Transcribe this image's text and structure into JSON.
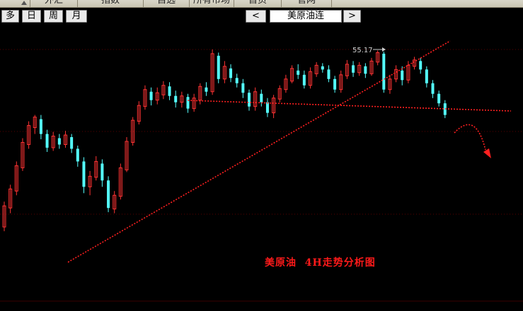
{
  "top_nav": {
    "tabs": [
      "外汇",
      "指数",
      "自选",
      "所有市场",
      "首页",
      "官网"
    ]
  },
  "toolbar": {
    "periods": [
      "多",
      "日",
      "周",
      "月"
    ],
    "prev": "<",
    "next": ">",
    "symbol": "美原油连"
  },
  "annotations": {
    "peak_label": "55.17",
    "caption": "美原油  4H走势分析图"
  },
  "colors": {
    "up": "#ff3333",
    "down": "#54ffff",
    "trendline": "#ff2020",
    "background": "#000000",
    "grid": "#5a0000"
  },
  "chart_data": {
    "type": "candlestick",
    "y_range": [
      36,
      57
    ],
    "candles": [
      [
        38.6,
        40.6,
        38.2,
        41.0
      ],
      [
        40.4,
        42.2,
        39.9,
        42.6
      ],
      [
        42.0,
        44.4,
        41.6,
        44.8
      ],
      [
        44.2,
        46.6,
        43.9,
        47.0
      ],
      [
        46.4,
        48.2,
        46.0,
        48.6
      ],
      [
        48.0,
        49.0,
        47.4,
        49.2
      ],
      [
        48.8,
        47.4,
        46.9,
        49.2
      ],
      [
        47.4,
        46.1,
        45.7,
        47.8
      ],
      [
        46.1,
        47.2,
        45.8,
        47.6
      ],
      [
        47.0,
        46.4,
        46.0,
        47.4
      ],
      [
        46.4,
        47.3,
        46.1,
        47.7
      ],
      [
        47.1,
        46.0,
        45.6,
        47.4
      ],
      [
        46.0,
        44.8,
        44.3,
        46.3
      ],
      [
        44.8,
        42.4,
        41.8,
        45.2
      ],
      [
        42.4,
        43.4,
        41.6,
        43.9
      ],
      [
        43.3,
        44.8,
        43.0,
        45.3
      ],
      [
        44.6,
        43.0,
        42.4,
        45.0
      ],
      [
        43.0,
        40.4,
        40.0,
        43.4
      ],
      [
        40.3,
        41.6,
        39.9,
        42.0
      ],
      [
        41.5,
        44.2,
        41.2,
        44.6
      ],
      [
        44.0,
        46.7,
        43.8,
        47.1
      ],
      [
        46.6,
        48.7,
        46.3,
        49.0
      ],
      [
        48.6,
        50.1,
        48.3,
        50.5
      ],
      [
        50.0,
        51.6,
        49.7,
        52.0
      ],
      [
        51.4,
        50.6,
        50.1,
        51.8
      ],
      [
        50.6,
        51.3,
        50.2,
        51.8
      ],
      [
        51.1,
        52.0,
        50.7,
        52.4
      ],
      [
        51.9,
        51.0,
        50.6,
        52.3
      ],
      [
        51.0,
        50.4,
        49.9,
        51.5
      ],
      [
        50.4,
        51.0,
        49.9,
        51.4
      ],
      [
        50.9,
        49.8,
        49.4,
        51.2
      ],
      [
        49.8,
        50.8,
        49.5,
        51.2
      ],
      [
        50.6,
        51.9,
        50.2,
        52.2
      ],
      [
        51.8,
        51.4,
        51.0,
        52.3
      ],
      [
        51.4,
        55.0,
        51.1,
        55.4
      ],
      [
        54.8,
        52.6,
        52.2,
        55.1
      ],
      [
        52.6,
        53.8,
        52.2,
        54.3
      ],
      [
        53.6,
        52.7,
        52.3,
        54.0
      ],
      [
        52.7,
        52.2,
        51.8,
        53.1
      ],
      [
        52.2,
        51.3,
        50.8,
        52.6
      ],
      [
        51.3,
        50.0,
        49.6,
        51.6
      ],
      [
        50.0,
        51.4,
        49.6,
        51.8
      ],
      [
        51.2,
        50.4,
        50.0,
        51.6
      ],
      [
        50.4,
        49.4,
        49.0,
        50.8
      ],
      [
        49.4,
        50.8,
        48.9,
        51.1
      ],
      [
        50.7,
        51.7,
        50.4,
        52.0
      ],
      [
        51.6,
        52.6,
        51.3,
        53.0
      ],
      [
        52.4,
        53.6,
        52.2,
        53.9
      ],
      [
        53.4,
        53.0,
        52.6,
        54.0
      ],
      [
        53.0,
        52.0,
        51.7,
        53.4
      ],
      [
        52.0,
        53.3,
        51.7,
        53.7
      ],
      [
        53.1,
        53.9,
        52.8,
        54.2
      ],
      [
        53.8,
        53.5,
        53.2,
        54.1
      ],
      [
        53.5,
        52.6,
        52.3,
        53.9
      ],
      [
        52.6,
        51.6,
        51.3,
        52.9
      ],
      [
        51.6,
        53.0,
        51.3,
        53.4
      ],
      [
        52.9,
        54.0,
        52.6,
        54.4
      ],
      [
        53.9,
        53.2,
        52.8,
        54.3
      ],
      [
        53.2,
        53.9,
        52.9,
        54.2
      ],
      [
        53.8,
        53.1,
        52.7,
        54.1
      ],
      [
        53.1,
        54.3,
        52.9,
        54.6
      ],
      [
        54.2,
        55.1,
        53.9,
        55.3
      ],
      [
        55.0,
        51.6,
        51.3,
        55.2
      ],
      [
        51.6,
        52.6,
        51.2,
        53.0
      ],
      [
        52.6,
        53.5,
        52.3,
        53.9
      ],
      [
        53.4,
        52.5,
        52.0,
        53.8
      ],
      [
        52.5,
        53.9,
        52.2,
        54.3
      ],
      [
        53.8,
        54.4,
        53.5,
        54.7
      ],
      [
        54.3,
        53.5,
        53.1,
        54.6
      ],
      [
        53.5,
        52.2,
        51.8,
        53.8
      ],
      [
        52.2,
        51.2,
        50.8,
        52.5
      ],
      [
        51.2,
        50.3,
        50.0,
        51.5
      ],
      [
        50.3,
        49.2,
        48.9,
        50.6
      ]
    ],
    "trendlines": [
      {
        "name": "support",
        "from": [
          0,
          40.3
        ],
        "to": [
          73,
          56.5
        ]
      },
      {
        "name": "resistance",
        "from": [
          8,
          51.1
        ],
        "to": [
          73,
          51.0
        ]
      }
    ]
  }
}
